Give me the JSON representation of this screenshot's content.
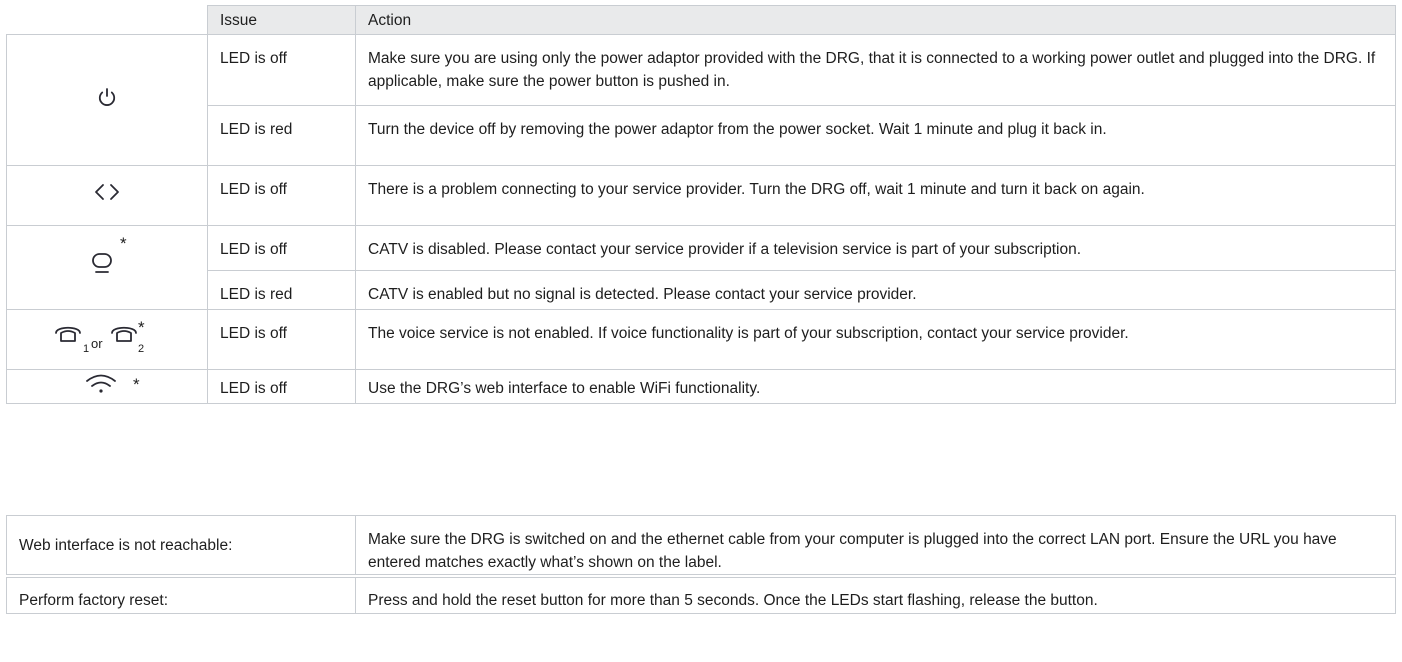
{
  "header": {
    "issue": "Issue",
    "action": "Action"
  },
  "rows": [
    {
      "icon": "power-icon",
      "issue": "LED is off",
      "action": "Make sure you are using only the power adaptor provided with the DRG, that it is connected to a working power outlet and plugged into the DRG. If applicable, make sure the power button is pushed in."
    },
    {
      "icon": "power-icon",
      "issue": "LED is red",
      "action": "Turn the device off by removing the power adaptor from the power socket. Wait 1 minute and plug it back in."
    },
    {
      "icon": "internet-icon",
      "issue": "LED is off",
      "action": "There is a problem connecting to your service provider. Turn the DRG off, wait 1 minute and turn it back on again."
    },
    {
      "icon": "tv-icon",
      "issue": "LED is off",
      "action": "CATV is disabled. Please contact your service provider if a television service is part of your subscription."
    },
    {
      "icon": "tv-icon",
      "issue": "LED is red",
      "action": "CATV is enabled but no signal is detected. Please contact your service provider."
    },
    {
      "icon": "phone-icon",
      "issue": "LED is off",
      "action": "The voice service is not enabled. If voice functionality is part of your subscription, contact your service provider."
    },
    {
      "icon": "wifi-icon",
      "issue": "LED is off",
      "action": "Use the DRG’s web interface to enable WiFi functionality."
    }
  ],
  "icons": {
    "asterisk": "*",
    "phone_sub1": "1",
    "phone_or": "or",
    "phone_sub2": "2"
  },
  "web": {
    "issue": "Web interface is not reachable:",
    "action": "Make sure the DRG is switched on and the ethernet cable from your computer is plugged into the correct LAN port. Ensure the URL you have entered matches exactly what’s shown on the label."
  },
  "reset": {
    "issue": "Perform factory reset:",
    "action": "Press and hold the reset button for more than 5 seconds. Once the LEDs start flashing, release the button."
  },
  "colors": {
    "header_bg": "#e9eaeb",
    "border": "#c9cdd2",
    "text": "#1e1e1e",
    "icon": "#2a2a33"
  }
}
